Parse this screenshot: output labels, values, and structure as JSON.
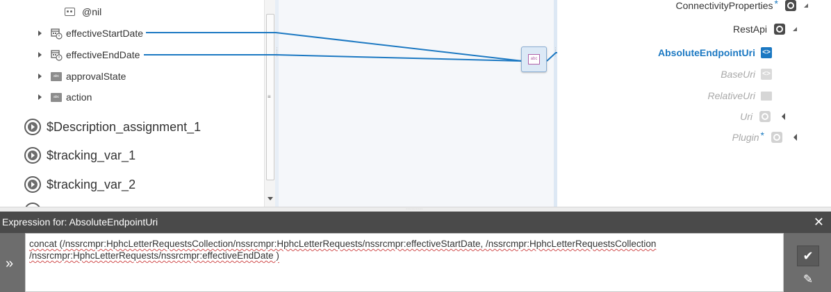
{
  "source_tree": {
    "fields": [
      {
        "label": "@nil",
        "icon": "nil-icon",
        "expandable": false
      },
      {
        "label": "effectiveStartDate",
        "icon": "calendar-icon",
        "expandable": true
      },
      {
        "label": "effectiveEndDate",
        "icon": "calendar-icon",
        "expandable": true
      },
      {
        "label": "approvalState",
        "icon": "string-abc-icon",
        "expandable": true
      },
      {
        "label": "action",
        "icon": "string-abc-icon",
        "expandable": true
      }
    ],
    "variables": [
      {
        "label": "$Description_assignment_1",
        "icon": "variable-icon"
      },
      {
        "label": "$tracking_var_1",
        "icon": "variable-icon"
      },
      {
        "label": "$tracking_var_2",
        "icon": "variable-icon"
      }
    ]
  },
  "function_node": {
    "label": "abc",
    "icon": "concat-function-icon"
  },
  "target_tree": {
    "items": [
      {
        "label": "ConnectivityProperties",
        "required": true,
        "asterisk": "*",
        "icon": "object-icon",
        "disabled": false
      },
      {
        "label": "RestApi",
        "required": false,
        "icon": "object-icon",
        "disabled": false
      },
      {
        "label": "AbsoluteEndpointUri",
        "icon": "uri-icon",
        "selected": true,
        "disabled": false
      },
      {
        "label": "BaseUri",
        "icon": "uri-icon",
        "disabled": true
      },
      {
        "label": "RelativeUri",
        "icon": "string-abc-icon",
        "disabled": true
      },
      {
        "label": "Uri",
        "icon": "object-icon",
        "disabled": true
      },
      {
        "label": "Plugin",
        "required": true,
        "asterisk": "*",
        "icon": "object-icon",
        "disabled": true
      }
    ]
  },
  "expression": {
    "title_prefix": "Expression for:",
    "title_target": "AbsoluteEndpointUri",
    "text": "concat (/nssrcmpr:HphcLetterRequestsCollection/nssrcmpr:HphcLetterRequests/nssrcmpr:effectiveStartDate, /nssrcmpr:HphcLetterRequestsCollection\n/nssrcmpr:HphcLetterRequests/nssrcmpr:effectiveEndDate )",
    "close_glyph": "✕",
    "expand_glyph": "»",
    "apply_glyph": "✔",
    "edit_glyph": "✎"
  },
  "colors": {
    "mapping_line": "#1b78c2",
    "selected_target": "#1b78c2",
    "header_bg": "#4a4a4a",
    "rail_bg": "#6d6d6d"
  }
}
